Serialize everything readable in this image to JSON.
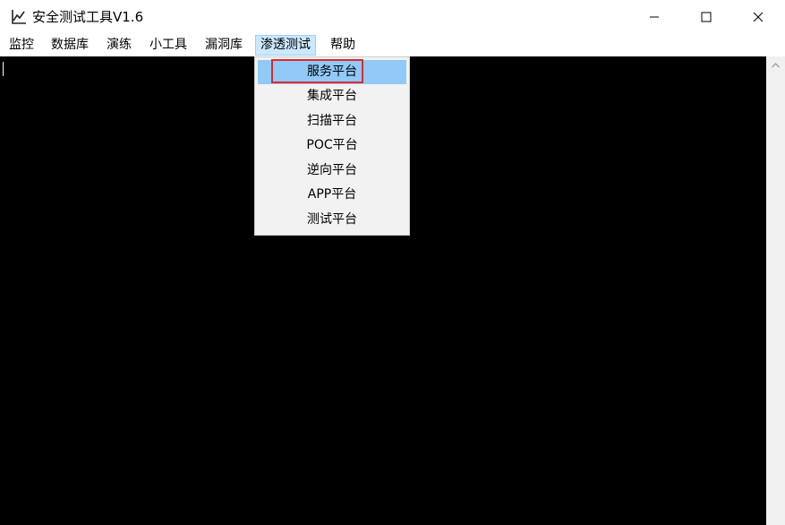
{
  "window": {
    "title": "安全测试工具V1.6",
    "icon": "chart-line-icon",
    "controls": [
      "minimize-icon",
      "maximize-icon",
      "close-icon"
    ]
  },
  "menubar": {
    "items": [
      {
        "label": "监控"
      },
      {
        "label": "数据库"
      },
      {
        "label": "演练"
      },
      {
        "label": "小工具"
      },
      {
        "label": "漏洞库"
      },
      {
        "label": "渗透测试",
        "active": true
      },
      {
        "label": "帮助"
      }
    ]
  },
  "dropdown": {
    "parent": "渗透测试",
    "items": [
      {
        "label": "服务平台",
        "highlighted": true
      },
      {
        "label": "集成平台"
      },
      {
        "label": "扫描平台"
      },
      {
        "label": "POC平台"
      },
      {
        "label": "逆向平台"
      },
      {
        "label": "APP平台"
      },
      {
        "label": "测试平台"
      }
    ]
  },
  "colors": {
    "console_bg": "#000000",
    "menu_active_bg": "#cce8ff",
    "dropdown_highlight": "#91c9f7",
    "annotation_box": "#e0282e"
  }
}
